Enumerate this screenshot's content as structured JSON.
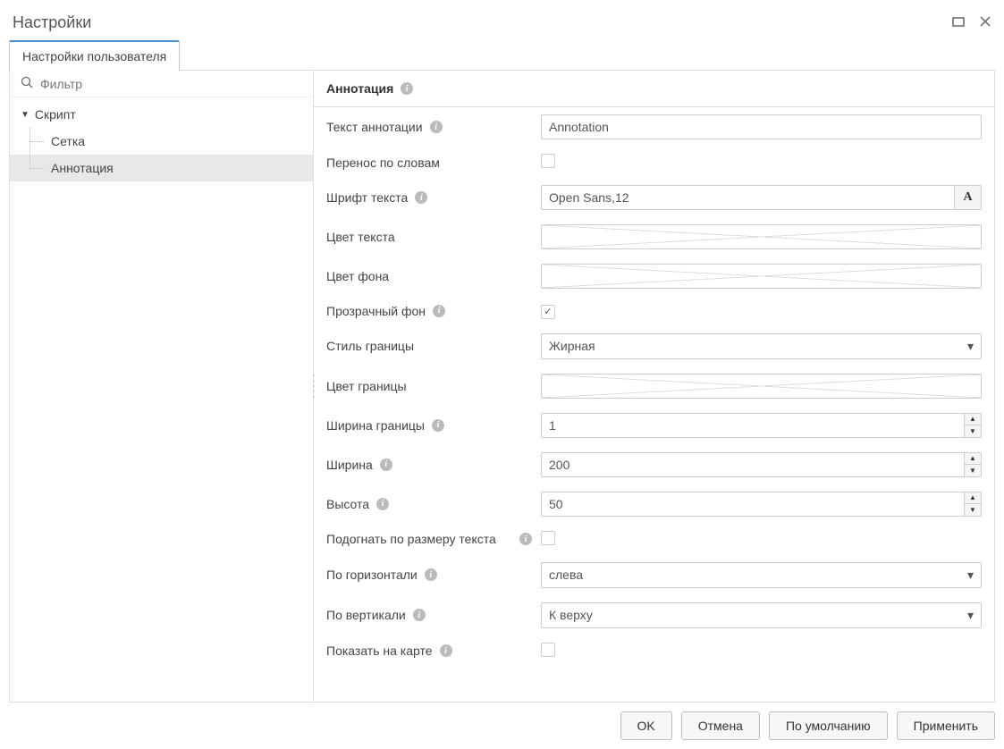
{
  "title": "Настройки",
  "tab_label": "Настройки пользователя",
  "filter_placeholder": "Фильтр",
  "tree": {
    "root": "Скрипт",
    "child1": "Сетка",
    "child2": "Аннотация"
  },
  "section_title": "Аннотация",
  "fields": {
    "annotation_text": {
      "label": "Текст аннотации",
      "value": "Annotation"
    },
    "word_wrap": {
      "label": "Перенос по словам",
      "checked": false
    },
    "text_font": {
      "label": "Шрифт текста",
      "value": "Open Sans,12"
    },
    "text_color": {
      "label": "Цвет текста"
    },
    "bg_color": {
      "label": "Цвет фона"
    },
    "transparent_bg": {
      "label": "Прозрачный фон",
      "checked": true
    },
    "border_style": {
      "label": "Стиль границы",
      "value": "Жирная"
    },
    "border_color": {
      "label": "Цвет границы"
    },
    "border_width": {
      "label": "Ширина границы",
      "value": "1"
    },
    "width": {
      "label": "Ширина",
      "value": "200"
    },
    "height": {
      "label": "Высота",
      "value": "50"
    },
    "fit_text": {
      "label": "Подогнать по размеру текста",
      "checked": false
    },
    "halign": {
      "label": "По горизонтали",
      "value": "слева"
    },
    "valign": {
      "label": "По вертикали",
      "value": "К верху"
    },
    "show_on_map": {
      "label": "Показать на карте",
      "checked": false
    }
  },
  "buttons": {
    "ok": "OK",
    "cancel": "Отмена",
    "default": "По умолчанию",
    "apply": "Применить"
  },
  "font_button_glyph": "A"
}
